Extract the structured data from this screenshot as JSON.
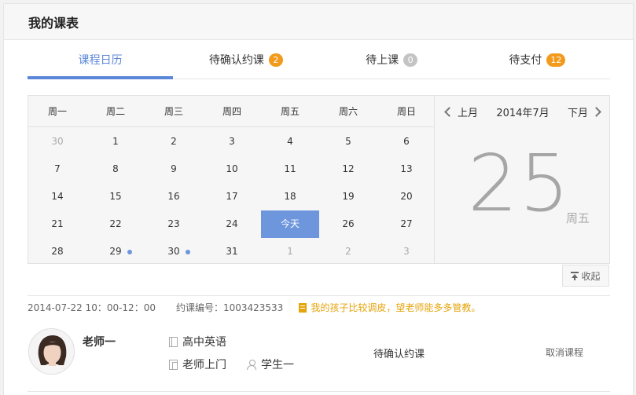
{
  "page": {
    "title": "我的课表"
  },
  "tabs": [
    {
      "label": "课程日历",
      "active": true,
      "badge": null,
      "badge_color": null
    },
    {
      "label": "待确认约课",
      "active": false,
      "badge": "2",
      "badge_color": "#f29a1c"
    },
    {
      "label": "待上课",
      "active": false,
      "badge": "0",
      "badge_color": "#c4c4c4"
    },
    {
      "label": "待支付",
      "active": false,
      "badge": "12",
      "badge_color": "#f29a1c"
    }
  ],
  "calendar": {
    "weekdays": [
      "周一",
      "周二",
      "周三",
      "周四",
      "周五",
      "周六",
      "周日"
    ],
    "cells": [
      {
        "text": "30",
        "muted": true
      },
      {
        "text": "1"
      },
      {
        "text": "2"
      },
      {
        "text": "3"
      },
      {
        "text": "4"
      },
      {
        "text": "5"
      },
      {
        "text": "6"
      },
      {
        "text": "7"
      },
      {
        "text": "8"
      },
      {
        "text": "9"
      },
      {
        "text": "10"
      },
      {
        "text": "11"
      },
      {
        "text": "12"
      },
      {
        "text": "13"
      },
      {
        "text": "14"
      },
      {
        "text": "15"
      },
      {
        "text": "16"
      },
      {
        "text": "17"
      },
      {
        "text": "18"
      },
      {
        "text": "19"
      },
      {
        "text": "20"
      },
      {
        "text": "21"
      },
      {
        "text": "22"
      },
      {
        "text": "23"
      },
      {
        "text": "24"
      },
      {
        "text": "今天",
        "today": true
      },
      {
        "text": "26"
      },
      {
        "text": "27"
      },
      {
        "text": "28"
      },
      {
        "text": "29",
        "dot": true
      },
      {
        "text": "30",
        "dot": true
      },
      {
        "text": "31"
      },
      {
        "text": "1",
        "muted": true
      },
      {
        "text": "2",
        "muted": true
      },
      {
        "text": "3",
        "muted": true
      }
    ],
    "prev_label": "上月",
    "next_label": "下月",
    "month_label": "2014年7月",
    "big_day": "25",
    "big_weekday": "周五",
    "collapse_label": "收起",
    "accent_color": "#6d96dd"
  },
  "lesson": {
    "time": "2014-07-22 10：00-12：00",
    "code": "约课编号：1003423533",
    "note": "我的孩子比较调皮，望老师能多多管教。",
    "teacher": "老师一",
    "subject": "高中英语",
    "mode": "老师上门",
    "student": "学生一",
    "status": "待确认约课",
    "cancel_label": "取消课程"
  }
}
